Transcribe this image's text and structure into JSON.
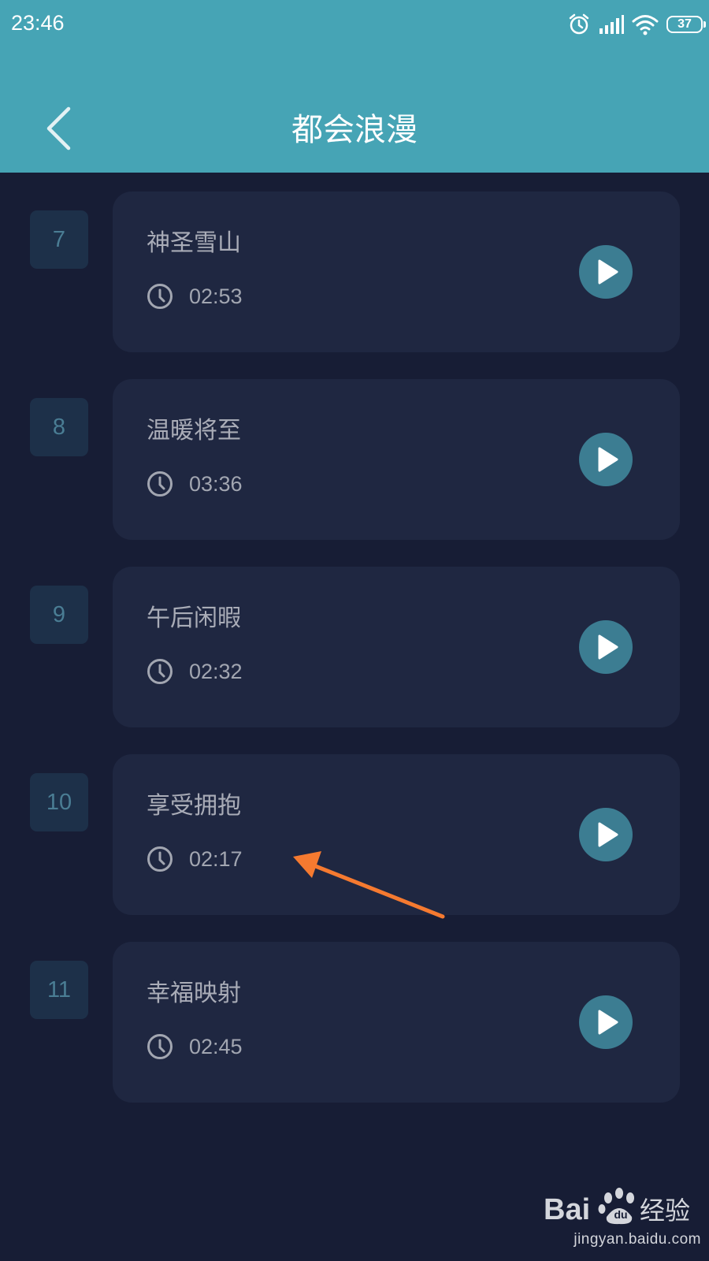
{
  "status_bar": {
    "time": "23:46",
    "battery": "37",
    "icons": [
      "alarm-icon",
      "signal-icon",
      "wifi-icon",
      "battery-icon"
    ]
  },
  "header": {
    "title": "都会浪漫",
    "back_icon": "chevron-left-icon"
  },
  "tracks": [
    {
      "number": "7",
      "title": "神圣雪山",
      "duration": "02:53"
    },
    {
      "number": "8",
      "title": "温暖将至",
      "duration": "03:36"
    },
    {
      "number": "9",
      "title": "午后闲暇",
      "duration": "02:32"
    },
    {
      "number": "10",
      "title": "享受拥抱",
      "duration": "02:17"
    },
    {
      "number": "11",
      "title": "幸福映射",
      "duration": "02:45"
    }
  ],
  "colors": {
    "header_bg": "#46a4b5",
    "page_bg": "#171d35",
    "card_bg": "#1f2741",
    "number_bg": "#1d3049",
    "play_button": "#3c7d92",
    "annotation_arrow": "#f57a30"
  },
  "watermark": {
    "url": "jingyan.baidu.com"
  }
}
